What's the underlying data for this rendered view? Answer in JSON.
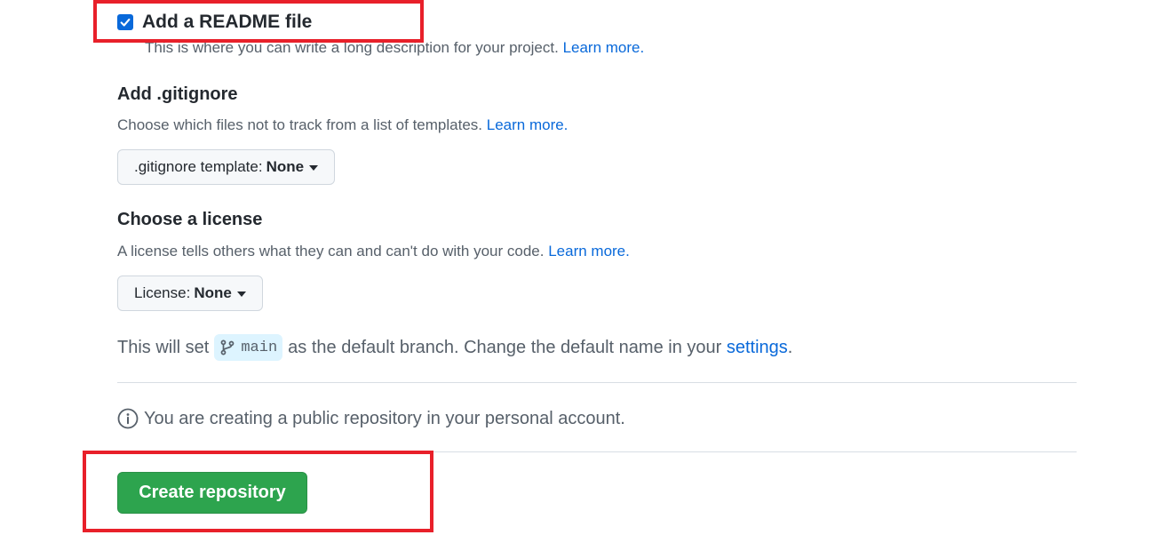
{
  "readme": {
    "label": "Add a README file",
    "checked": true,
    "description": "This is where you can write a long description for your project.",
    "learn_more": "Learn more."
  },
  "gitignore": {
    "title": "Add .gitignore",
    "description": "Choose which files not to track from a list of templates.",
    "learn_more": "Learn more.",
    "dropdown_label": ".gitignore template:",
    "dropdown_value": "None"
  },
  "license": {
    "title": "Choose a license",
    "description": "A license tells others what they can and can't do with your code.",
    "learn_more": "Learn more.",
    "dropdown_label": "License:",
    "dropdown_value": "None"
  },
  "branch": {
    "prefix": "This will set",
    "name": "main",
    "suffix": "as the default branch. Change the default name in your",
    "settings_link": "settings",
    "end": "."
  },
  "notice": {
    "text": "You are creating a public repository in your personal account."
  },
  "actions": {
    "create_label": "Create repository"
  },
  "colors": {
    "accent": "#0969da",
    "primary_button": "#2da44e",
    "highlight": "#e8202a",
    "branch_pill_bg": "#ddf4ff"
  },
  "icons": {
    "checkbox": "check-icon",
    "branch": "git-branch-icon",
    "info": "info-icon",
    "caret": "triangle-down-icon"
  }
}
